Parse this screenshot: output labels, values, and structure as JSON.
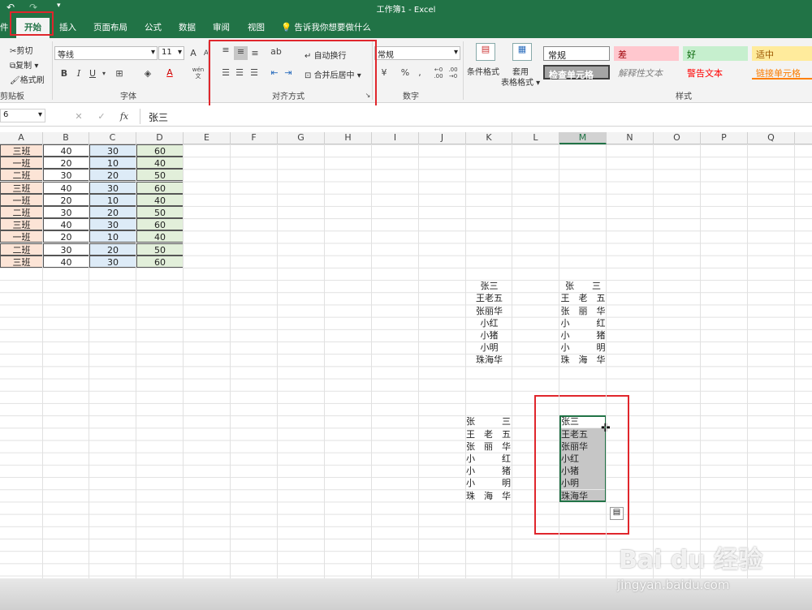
{
  "title": "工作簿1 - Excel",
  "tabs": [
    "件",
    "开始",
    "插入",
    "页面布局",
    "公式",
    "数据",
    "审阅",
    "视图"
  ],
  "tell_me": "告诉我你想要做什么",
  "clipboard": {
    "cut": "剪切",
    "copy": "复制",
    "painter": "格式刷",
    "group": "剪贴板"
  },
  "font": {
    "name": "等线",
    "size": "11",
    "group": "字体",
    "bold": "B",
    "italic": "I",
    "underline": "U",
    "font_color": "A",
    "wen": "wén 文"
  },
  "alignment": {
    "wrap": "自动换行",
    "merge": "合并后居中",
    "group": "对齐方式"
  },
  "number": {
    "format": "常规",
    "percent": "%",
    "comma": ",",
    "group": "数字",
    "inc": "←0 .00",
    "dec": ".00 →0"
  },
  "styles": {
    "cond": "条件格式",
    "table_line1": "套用",
    "table_line2": "表格格式",
    "group": "样式",
    "normal": "常规",
    "bad": "差",
    "good": "好",
    "neutral": "适中",
    "check": "检查单元格",
    "explain": "解释性文本",
    "warn": "警告文本",
    "link": "链接单元格"
  },
  "formula": {
    "namebox": "6",
    "cancel": "✕",
    "enter": "✓",
    "fx": "fx",
    "value": "张三"
  },
  "columns": [
    "A",
    "B",
    "C",
    "D",
    "E",
    "F",
    "G",
    "H",
    "I",
    "J",
    "K",
    "L",
    "M",
    "N",
    "O",
    "P",
    "Q"
  ],
  "table": [
    [
      "三班",
      "40",
      "30",
      "60"
    ],
    [
      "一班",
      "20",
      "10",
      "40"
    ],
    [
      "二班",
      "30",
      "20",
      "50"
    ],
    [
      "三班",
      "40",
      "30",
      "60"
    ],
    [
      "一班",
      "20",
      "10",
      "40"
    ],
    [
      "二班",
      "30",
      "20",
      "50"
    ],
    [
      "三班",
      "40",
      "30",
      "60"
    ],
    [
      "一班",
      "20",
      "10",
      "40"
    ],
    [
      "二班",
      "30",
      "20",
      "50"
    ],
    [
      "三班",
      "40",
      "30",
      "60"
    ]
  ],
  "list_k1": [
    "张三",
    "王老五",
    "张丽华",
    "小红",
    "小猪",
    "小明",
    "珠海华"
  ],
  "list_m1": [
    "张　　三",
    "王　老　五",
    "张　丽　华",
    "小　　　红",
    "小　　　猪",
    "小　　　明",
    "珠　海　华"
  ],
  "list_k2": [
    "张　　　三",
    "王　老　五",
    "张　丽　华",
    "小　　　红",
    "小　　　猪",
    "小　　　明",
    "珠　海　华"
  ],
  "list_m2": [
    "张三",
    "王老五",
    "张丽华",
    "小红",
    "小猪",
    "小明",
    "珠海华"
  ],
  "watermark": {
    "brand": "Bai du 经验",
    "url": "jingyan.baidu.com"
  },
  "colors": {
    "accent": "#217346",
    "highlight": "#e0262c",
    "orange": "#fce4d6",
    "blue": "#ddebf7",
    "green": "#e2efda"
  }
}
